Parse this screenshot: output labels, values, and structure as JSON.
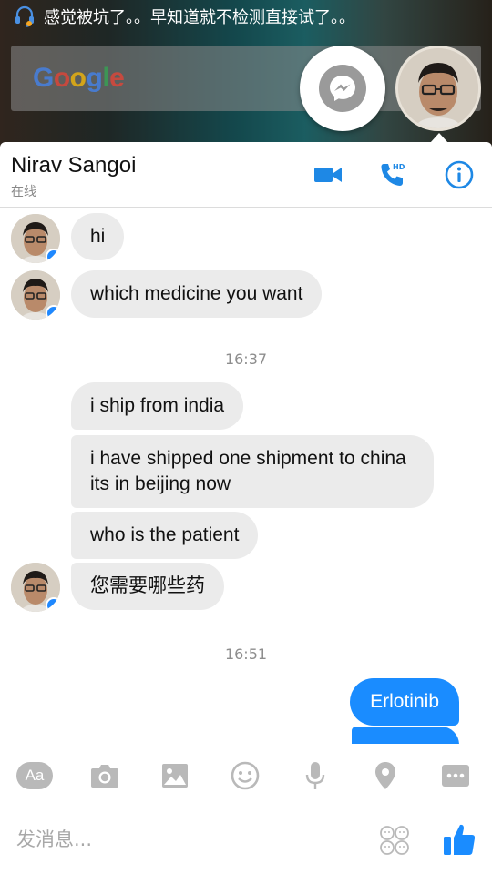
{
  "notification": {
    "text": "感觉被坑了。。早知道就不检测直接试了。。"
  },
  "google_bar": {
    "logo": [
      "G",
      "o",
      "o",
      "g",
      "l",
      "e"
    ]
  },
  "header": {
    "name": "Nirav Sangoi",
    "status": "在线"
  },
  "thread": {
    "in_messages": [
      {
        "text": "hi"
      },
      {
        "text": "which medicine you want"
      },
      {
        "text": "i ship from india"
      },
      {
        "text": "i have shipped one shipment to china its in beijing now"
      },
      {
        "text": "who is the patient"
      },
      {
        "text": "您需要哪些药"
      }
    ],
    "timestamps": [
      "16:37",
      "16:51"
    ],
    "out_messages": [
      {
        "text": "Erlotinib"
      },
      {
        "text": ""
      }
    ]
  },
  "toolbar": {
    "aa_label": "Aa"
  },
  "composer": {
    "placeholder": "发消息..."
  },
  "colors": {
    "accent": "#1a8cff",
    "incoming_bubble": "#ebebeb",
    "header_icon": "#1e88e5"
  },
  "icons": {
    "notification": "headset-icon",
    "floating_messenger": "messenger-icon",
    "video": "video-camera-icon",
    "call": "hd-phone-icon",
    "info": "info-icon",
    "camera": "camera-icon",
    "gallery": "image-icon",
    "emoji": "smiley-icon",
    "mic": "microphone-icon",
    "location": "location-pin-icon",
    "more": "more-dots-icon",
    "stickers": "sticker-faces-icon",
    "like": "thumbs-up-icon"
  }
}
